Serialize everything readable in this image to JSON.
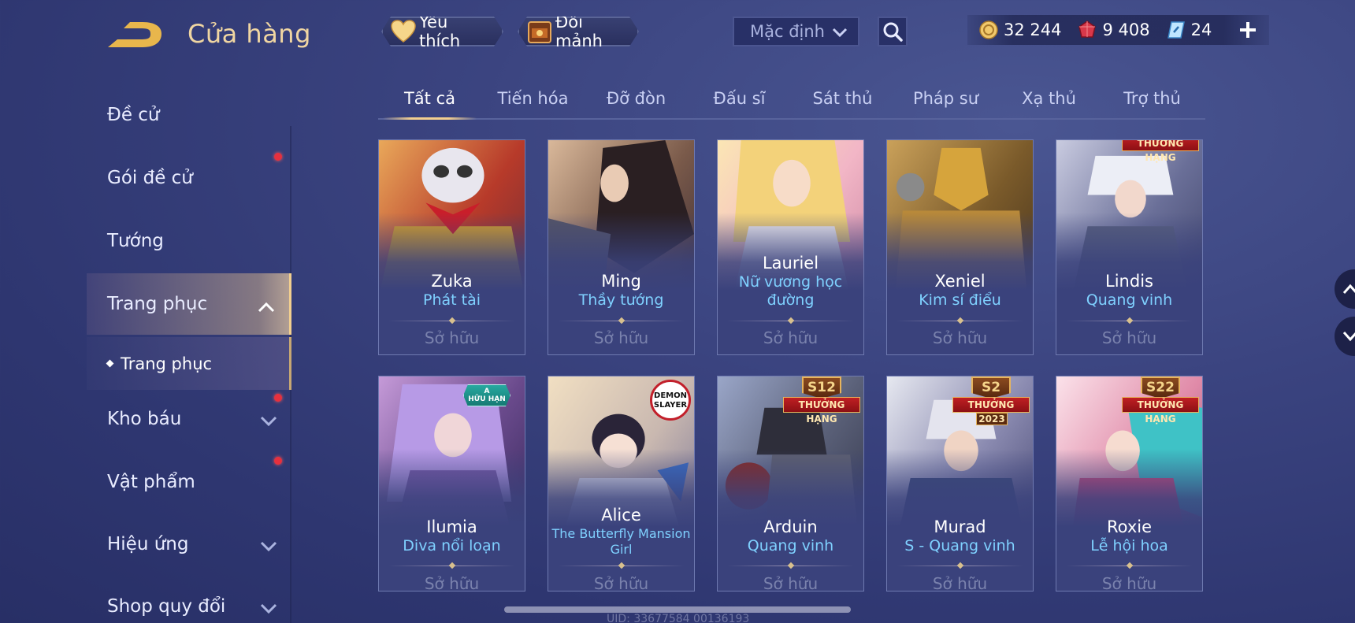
{
  "header": {
    "title": "Cửa hàng",
    "favorite_label": "Yêu thích",
    "shard_exchange_label": "Đổi mảnh",
    "sort_value": "Mặc định"
  },
  "currency": {
    "gold": "32 244",
    "gems": "9 408",
    "vouchers": "24"
  },
  "sidebar": {
    "items": [
      {
        "label": "Đề cử"
      },
      {
        "label": "Gói đề cử"
      },
      {
        "label": "Tướng"
      },
      {
        "label": "Trang phục"
      },
      {
        "label": "Kho báu"
      },
      {
        "label": "Vật phẩm"
      },
      {
        "label": "Hiệu ứng"
      },
      {
        "label": "Shop quy đổi"
      }
    ],
    "sub_item": "Trang phục"
  },
  "tabs": [
    "Tất cả",
    "Tiến hóa",
    "Đỡ đòn",
    "Đấu sĩ",
    "Sát thủ",
    "Pháp sư",
    "Xạ thủ",
    "Trợ thủ"
  ],
  "skins": [
    {
      "hero": "Zuka",
      "skin": "Phát tài",
      "status": "Sở hữu"
    },
    {
      "hero": "Ming",
      "skin": "Thầy tướng",
      "status": "Sở hữu"
    },
    {
      "hero": "Lauriel",
      "skin": "Nữ vương học đường",
      "status": "Sở hữu"
    },
    {
      "hero": "Xeniel",
      "skin": "Kim sí điểu",
      "status": "Sở hữu"
    },
    {
      "hero": "Lindis",
      "skin": "Quang vinh",
      "status": "Sở hữu",
      "badge": "THƯỞNG HẠNG"
    },
    {
      "hero": "Ilumia",
      "skin": "Diva nổi loạn",
      "status": "Sở hữu",
      "badge_grade": "A",
      "badge_text": "HỮU HẠN"
    },
    {
      "hero": "Alice",
      "skin": "The Butterfly Mansion Girl",
      "status": "Sở hữu",
      "badge_text": "DEMON SLAYER"
    },
    {
      "hero": "Arduin",
      "skin": "Quang vinh",
      "status": "Sở hữu",
      "badge_season": "S12",
      "badge_text": "THƯỞNG HẠNG"
    },
    {
      "hero": "Murad",
      "skin": "S - Quang vinh",
      "status": "Sở hữu",
      "badge_season": "S2",
      "badge_text": "THƯỞNG HẠNG",
      "badge_year": "2023"
    },
    {
      "hero": "Roxie",
      "skin": "Lễ hội hoa",
      "status": "Sở hữu",
      "badge_season": "S22",
      "badge_text": "THƯỞNG HẠNG"
    }
  ],
  "footer": {
    "uid": "UID: 33677584 00136193"
  },
  "colors": {
    "accent_gold": "#f2cf8f",
    "skin_name": "#7fd1ff",
    "owned_text": "#7a82ad",
    "notification": "#e6303e"
  }
}
